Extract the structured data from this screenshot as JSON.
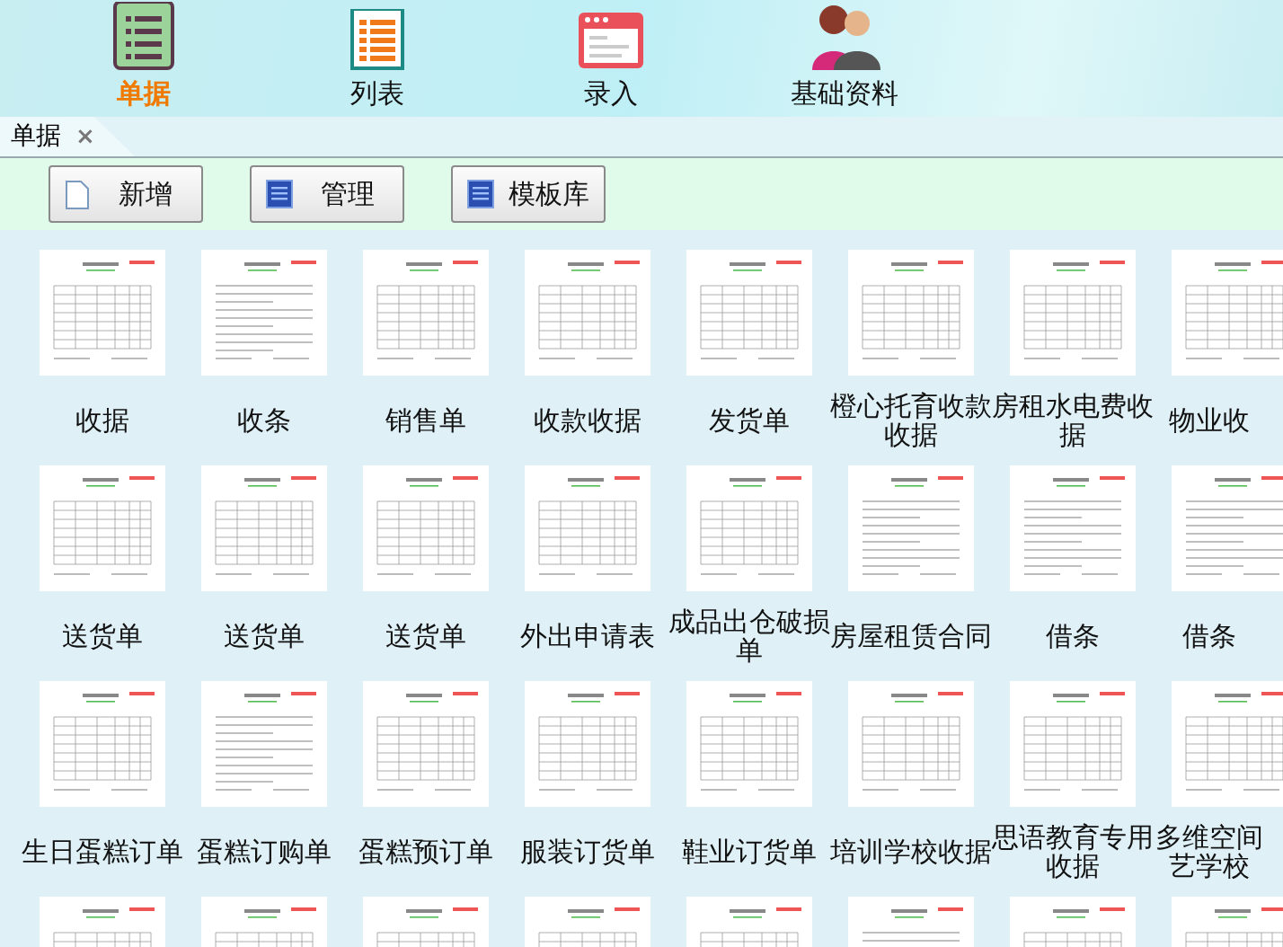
{
  "nav": [
    {
      "label": "单据",
      "kind": "clipboard",
      "selected": true
    },
    {
      "label": "列表",
      "kind": "list",
      "selected": false
    },
    {
      "label": "录入",
      "kind": "window",
      "selected": false
    },
    {
      "label": "基础资料",
      "kind": "people",
      "selected": false
    }
  ],
  "tabs": [
    {
      "label": "单据",
      "close": "×",
      "selected": true
    }
  ],
  "toolbar": [
    {
      "label": "新增",
      "kind": "page"
    },
    {
      "label": "管理",
      "kind": "book"
    },
    {
      "label": "模板库",
      "kind": "book"
    }
  ],
  "templates": [
    {
      "label": "收据",
      "kind": "table"
    },
    {
      "label": "收条",
      "kind": "text"
    },
    {
      "label": "销售单",
      "kind": "table"
    },
    {
      "label": "收款收据",
      "kind": "table"
    },
    {
      "label": "发货单",
      "kind": "table"
    },
    {
      "label": "橙心托育收款收据",
      "kind": "table"
    },
    {
      "label": "房租水电费收据",
      "kind": "table"
    },
    {
      "label": "物业收",
      "kind": "table"
    },
    {
      "label": "送货单",
      "kind": "table"
    },
    {
      "label": "送货单",
      "kind": "table"
    },
    {
      "label": "送货单",
      "kind": "table"
    },
    {
      "label": "外出申请表",
      "kind": "table"
    },
    {
      "label": "成品出仓破损单",
      "kind": "table"
    },
    {
      "label": "房屋租赁合同",
      "kind": "text"
    },
    {
      "label": "借条",
      "kind": "text"
    },
    {
      "label": "借条",
      "kind": "text"
    },
    {
      "label": "生日蛋糕订单",
      "kind": "table"
    },
    {
      "label": "蛋糕订购单",
      "kind": "text"
    },
    {
      "label": "蛋糕预订单",
      "kind": "table"
    },
    {
      "label": "服装订货单",
      "kind": "table"
    },
    {
      "label": "鞋业订货单",
      "kind": "table"
    },
    {
      "label": "培训学校收据",
      "kind": "table"
    },
    {
      "label": "思语教育专用收据",
      "kind": "table"
    },
    {
      "label": "多维空间艺学校",
      "kind": "table"
    },
    {
      "kind": "table"
    },
    {
      "kind": "table"
    },
    {
      "kind": "table"
    },
    {
      "kind": "table"
    },
    {
      "kind": "table"
    },
    {
      "kind": "text"
    },
    {
      "kind": "table"
    },
    {
      "kind": "table"
    }
  ]
}
